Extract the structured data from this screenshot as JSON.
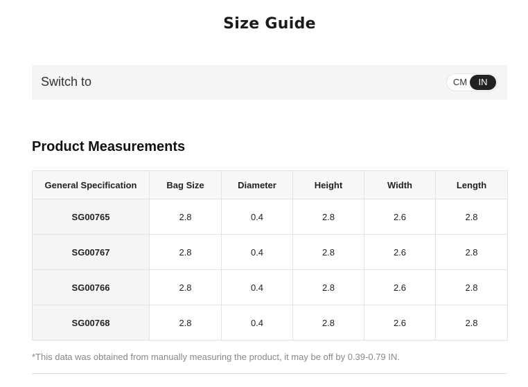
{
  "page": {
    "title": "Size Guide"
  },
  "unit_switch": {
    "label": "Switch to",
    "options": [
      "CM",
      "IN"
    ],
    "selected": "IN"
  },
  "measurements": {
    "title": "Product Measurements",
    "columns": [
      "General Specification",
      "Bag Size",
      "Diameter",
      "Height",
      "Width",
      "Length"
    ],
    "rows": [
      [
        "SG00765",
        "2.8",
        "0.4",
        "2.8",
        "2.6",
        "2.8"
      ],
      [
        "SG00767",
        "2.8",
        "0.4",
        "2.8",
        "2.6",
        "2.8"
      ],
      [
        "SG00766",
        "2.8",
        "0.4",
        "2.8",
        "2.6",
        "2.8"
      ],
      [
        "SG00768",
        "2.8",
        "0.4",
        "2.8",
        "2.6",
        "2.8"
      ]
    ],
    "footnote": "*This data was obtained from manually measuring the product, it may be off by 0.39-0.79 IN."
  },
  "colors": {
    "toggle_active_bg": "#222222",
    "switch_bar_bg": "#f5f5f5",
    "table_border": "#e2e2e2"
  }
}
